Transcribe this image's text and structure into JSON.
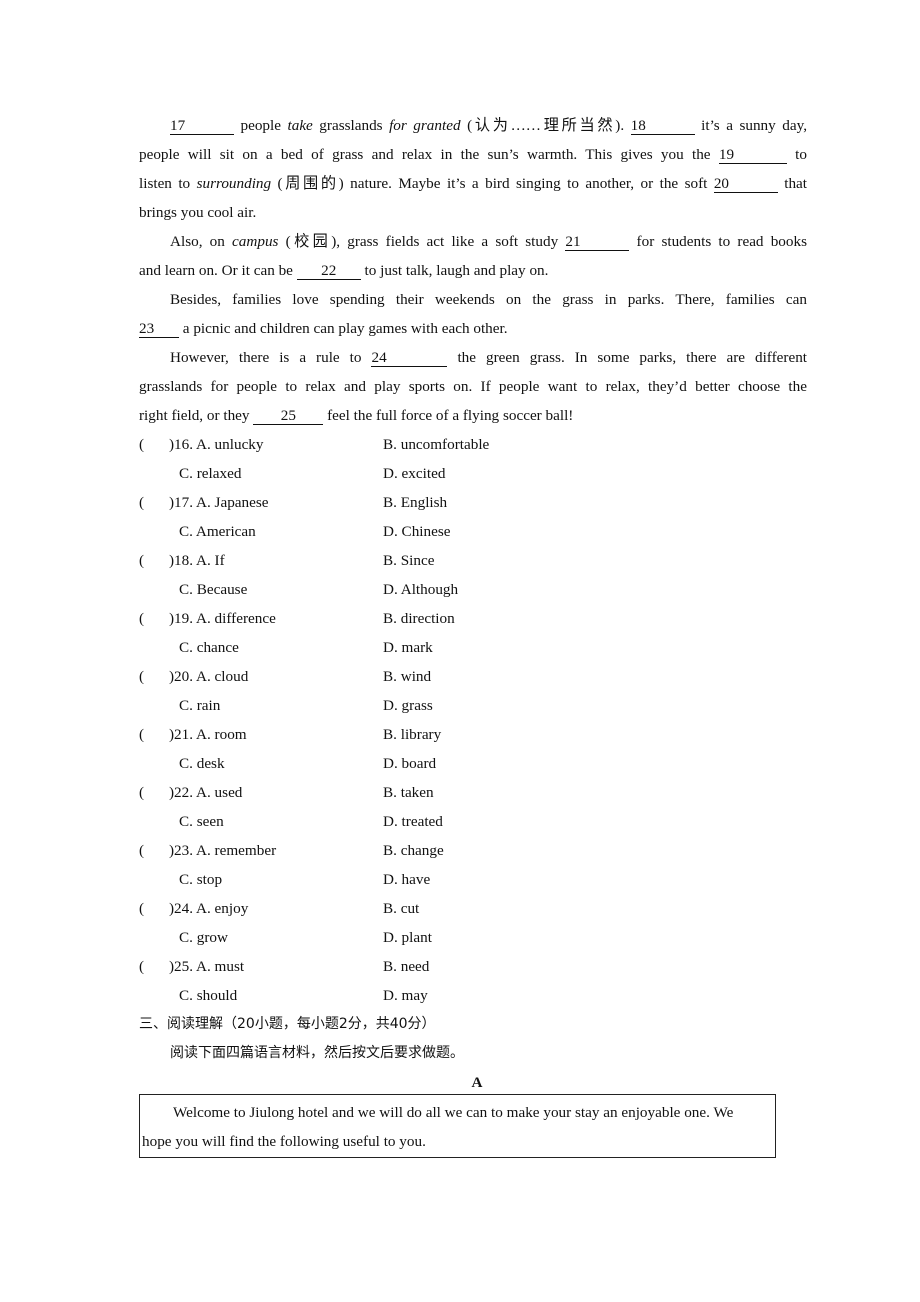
{
  "passage": {
    "p1": {
      "blank17": "17",
      "t1": " people ",
      "em_take": "take",
      "t2": " grasslands ",
      "em_granted": "for granted",
      "t3": " (认为……理所当然). ",
      "blank18": "18",
      "t4": " it’s a sunny day,",
      "line2a": "people will sit on a bed of grass and relax in the sun’s warmth. This gives you the ",
      "blank19": "19",
      "line2b": " to",
      "line3a": "listen to ",
      "em_surrounding": "surrounding",
      "line3b": " (周围的) nature. Maybe it’s a bird singing to another, or the soft ",
      "blank20": "20",
      "line3c": " that",
      "line4": "brings you cool air."
    },
    "p2": {
      "t1": "Also, on ",
      "em_campus": "campus",
      "t2": " (校园), grass fields act like a soft study ",
      "blank21": "21",
      "t3": " for students to read books",
      "line2a": "and learn on. Or it can be ",
      "blank22": "22",
      "line2b": " to just talk, laugh and play on."
    },
    "p3": {
      "line1": "Besides, families love spending their weekends on the grass in parks. There, families can",
      "blank23": "23",
      "line2": " a picnic and children can play games with each other."
    },
    "p4": {
      "t1": "However, there is a rule to ",
      "blank24": "24",
      "t2": " the green grass. In some parks, there are different",
      "line2": "grasslands for people to relax and play sports on. If people want to relax, they’d better choose the",
      "line3a": "right field, or they ",
      "blank25": "25",
      "line3b": " feel the full force of a flying soccer ball!"
    }
  },
  "questions": [
    {
      "num": ")16. A. unlucky",
      "B": "B. uncomfortable",
      "C": "C. relaxed",
      "D": "D. excited"
    },
    {
      "num": ")17. A. Japanese",
      "B": "B. English",
      "C": "C. American",
      "D": "D. Chinese"
    },
    {
      "num": ")18. A. If",
      "B": "B. Since",
      "C": "C. Because",
      "D": "D. Although"
    },
    {
      "num": ")19. A. difference",
      "B": "B. direction",
      "C": "C. chance",
      "D": "D. mark"
    },
    {
      "num": ")20. A. cloud",
      "B": "B. wind",
      "C": "C. rain",
      "D": "D. grass"
    },
    {
      "num": ")21. A. room",
      "B": "B. library",
      "C": "C. desk",
      "D": "D. board"
    },
    {
      "num": ")22. A. used",
      "B": "B. taken",
      "C": "C. seen",
      "D": "D. treated"
    },
    {
      "num": ")23. A. remember",
      "B": "B. change",
      "C": "C. stop",
      "D": "D. have"
    },
    {
      "num": ")24. A. enjoy",
      "B": "B. cut",
      "C": "C. grow",
      "D": "D. plant"
    },
    {
      "num": ")25. A. must",
      "B": "B. need",
      "C": "C. should",
      "D": "D. may"
    }
  ],
  "paren_open": "(",
  "section": {
    "title": "三、阅读理解（20小题，每小题2分，共40分）",
    "instruction": "阅读下面四篇语言材料，然后按文后要求做题。",
    "passage_label": "A"
  },
  "box": {
    "line1": "Welcome to Jiulong hotel and we will do all we can to make your stay an enjoyable one. We",
    "line2": "hope you will find the following useful to you."
  }
}
